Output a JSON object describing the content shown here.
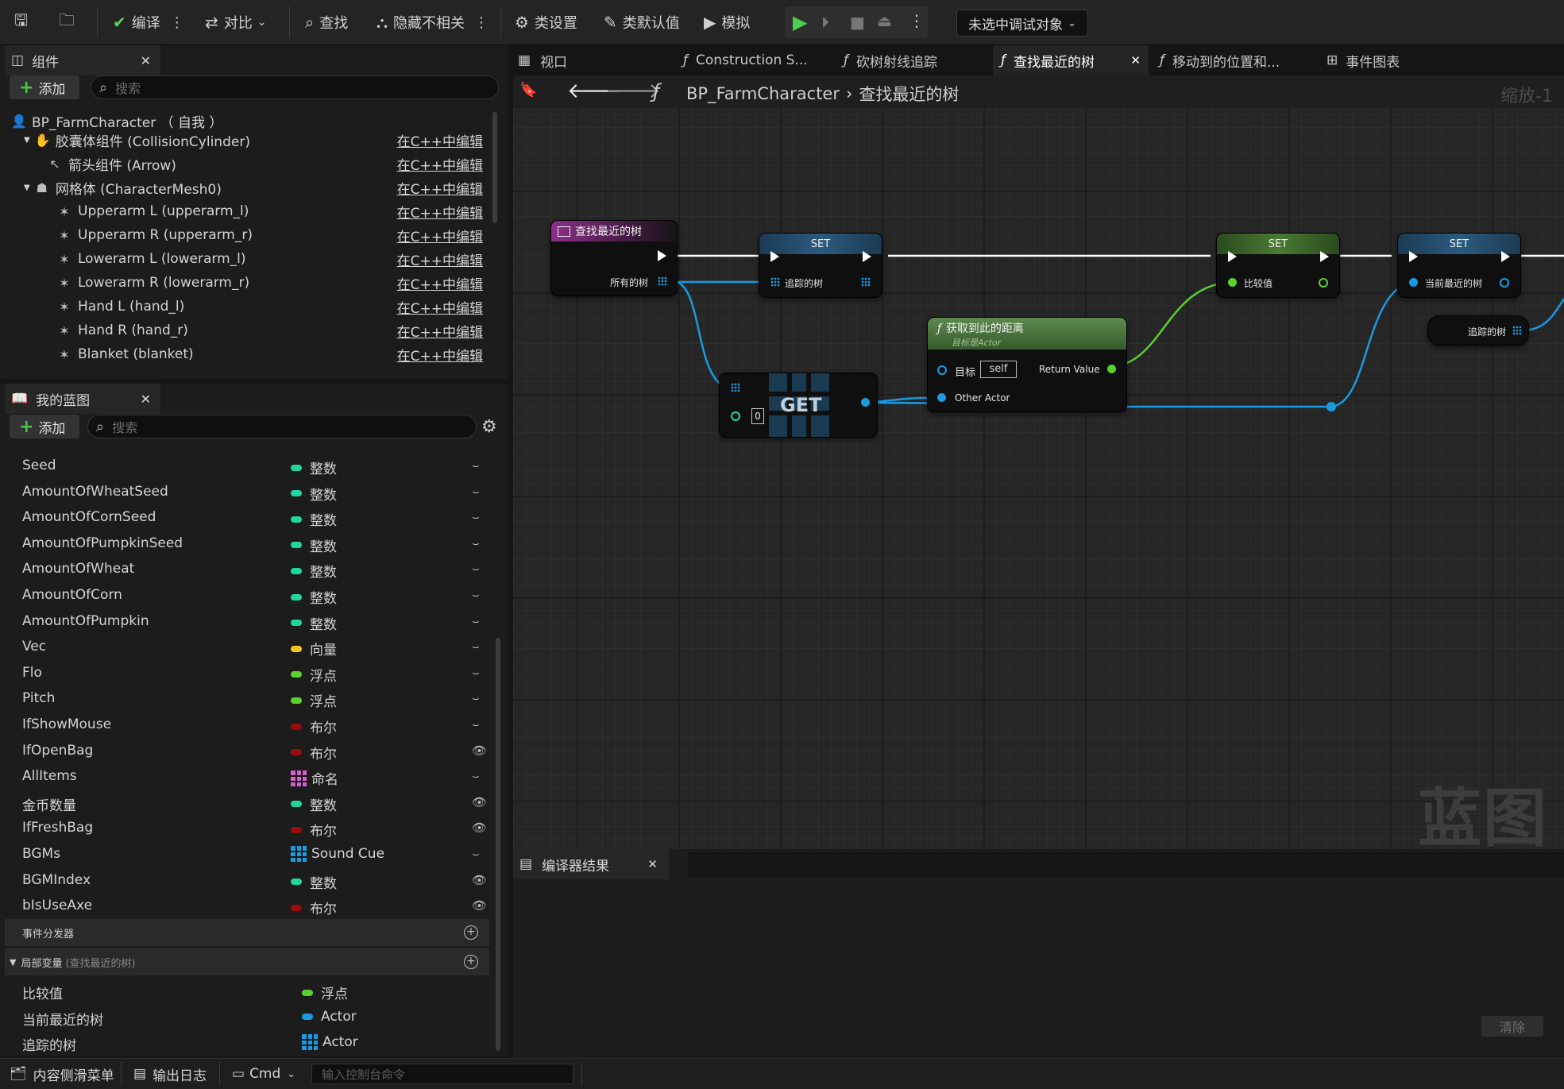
{
  "toolbar": {
    "compile": "编译",
    "diff": "对比",
    "find": "查找",
    "hide_unrelated": "隐藏不相关",
    "class_settings": "类设置",
    "class_defaults": "类默认值",
    "simulate": "模拟",
    "debug_target": "未选中调试对象"
  },
  "components_panel": {
    "title": "组件",
    "add": "添加",
    "search_placeholder": "搜索",
    "root": "BP_FarmCharacter （ 自我 ）",
    "edit_cpp": "在C++中编辑",
    "items": [
      {
        "label": "胶囊体组件 (CollisionCylinder)"
      },
      {
        "label": "箭头组件 (Arrow)"
      },
      {
        "label": "网格体 (CharacterMesh0)"
      },
      {
        "label": "Upperarm L (upperarm_l)"
      },
      {
        "label": "Upperarm R (upperarm_r)"
      },
      {
        "label": "Lowerarm L (lowerarm_l)"
      },
      {
        "label": "Lowerarm R (lowerarm_r)"
      },
      {
        "label": "Hand L (hand_l)"
      },
      {
        "label": "Hand R (hand_r)"
      },
      {
        "label": "Blanket (blanket)"
      }
    ]
  },
  "myblueprint_panel": {
    "title": "我的蓝图",
    "add": "添加",
    "search_placeholder": "搜索",
    "variables": [
      {
        "name": "Seed",
        "type": "整数",
        "color": "#1fd6a0",
        "eye": false
      },
      {
        "name": "AmountOfWheatSeed",
        "type": "整数",
        "color": "#1fd6a0",
        "eye": false
      },
      {
        "name": "AmountOfCornSeed",
        "type": "整数",
        "color": "#1fd6a0",
        "eye": false
      },
      {
        "name": "AmountOfPumpkinSeed",
        "type": "整数",
        "color": "#1fd6a0",
        "eye": false
      },
      {
        "name": "AmountOfWheat",
        "type": "整数",
        "color": "#1fd6a0",
        "eye": false
      },
      {
        "name": "AmountOfCorn",
        "type": "整数",
        "color": "#1fd6a0",
        "eye": false
      },
      {
        "name": "AmountOfPumpkin",
        "type": "整数",
        "color": "#1fd6a0",
        "eye": false
      },
      {
        "name": "Vec",
        "type": "向量",
        "color": "#f5c518",
        "eye": false
      },
      {
        "name": "Flo",
        "type": "浮点",
        "color": "#5ad12e",
        "eye": false
      },
      {
        "name": "Pitch",
        "type": "浮点",
        "color": "#5ad12e",
        "eye": false
      },
      {
        "name": "IfShowMouse",
        "type": "布尔",
        "color": "#9a0c0c",
        "eye": false
      },
      {
        "name": "IfOpenBag",
        "type": "布尔",
        "color": "#9a0c0c",
        "eye": true
      },
      {
        "name": "AllItems",
        "type": "命名",
        "color": "#d35fd0",
        "eye": false
      },
      {
        "name": "金币数量",
        "type": "整数",
        "color": "#1fd6a0",
        "eye": true
      },
      {
        "name": "IfFreshBag",
        "type": "布尔",
        "color": "#9a0c0c",
        "eye": true
      },
      {
        "name": "BGMs",
        "type": "Sound Cue",
        "color": "#1a9be0",
        "eye": false
      },
      {
        "name": "BGMIndex",
        "type": "整数",
        "color": "#1fd6a0",
        "eye": true
      },
      {
        "name": "bIsUseAxe",
        "type": "布尔",
        "color": "#9a0c0c",
        "eye": true
      }
    ],
    "event_dispatchers": "事件分发器",
    "local_vars_title": "局部变量",
    "local_vars_sub": "(查找最近的树)",
    "local_vars": [
      {
        "name": "比较值",
        "type": "浮点",
        "color": "#5ad12e"
      },
      {
        "name": "当前最近的树",
        "type": "Actor",
        "color": "#1a9be0"
      },
      {
        "name": "追踪的树",
        "type": "Actor",
        "color": "#1a9be0"
      }
    ]
  },
  "editor_tabs": [
    {
      "label": "视口"
    },
    {
      "label": "Construction S..."
    },
    {
      "label": "砍树射线追踪"
    },
    {
      "label": "查找最近的树"
    },
    {
      "label": "移动到的位置和..."
    },
    {
      "label": "事件图表"
    }
  ],
  "graph": {
    "breadcrumb_root": "BP_FarmCharacter",
    "breadcrumb_leaf": "查找最近的树",
    "zoom": "缩放-1",
    "watermark": "蓝图",
    "nodes": {
      "entry_title": "查找最近的树",
      "entry_pin": "所有的树",
      "set1_title": "SET",
      "set1_pin": "追踪的树",
      "get_title": "GET",
      "get_index": "0",
      "dist_title": "获取到此的距离",
      "dist_sub": "目标是Actor",
      "dist_target": "目标",
      "dist_self": "self",
      "dist_other": "Other Actor",
      "dist_return": "Return Value",
      "set2_title": "SET",
      "set2_pin": "比较值",
      "set3_title": "SET",
      "set3_pin": "当前最近的树",
      "var_node": "追踪的树"
    }
  },
  "compiler": {
    "title": "编译器结果",
    "clear": "清除"
  },
  "statusbar": {
    "content_drawer": "内容侧滑菜单",
    "output_log": "输出日志",
    "cmd": "Cmd",
    "console_placeholder": "输入控制台命令"
  }
}
